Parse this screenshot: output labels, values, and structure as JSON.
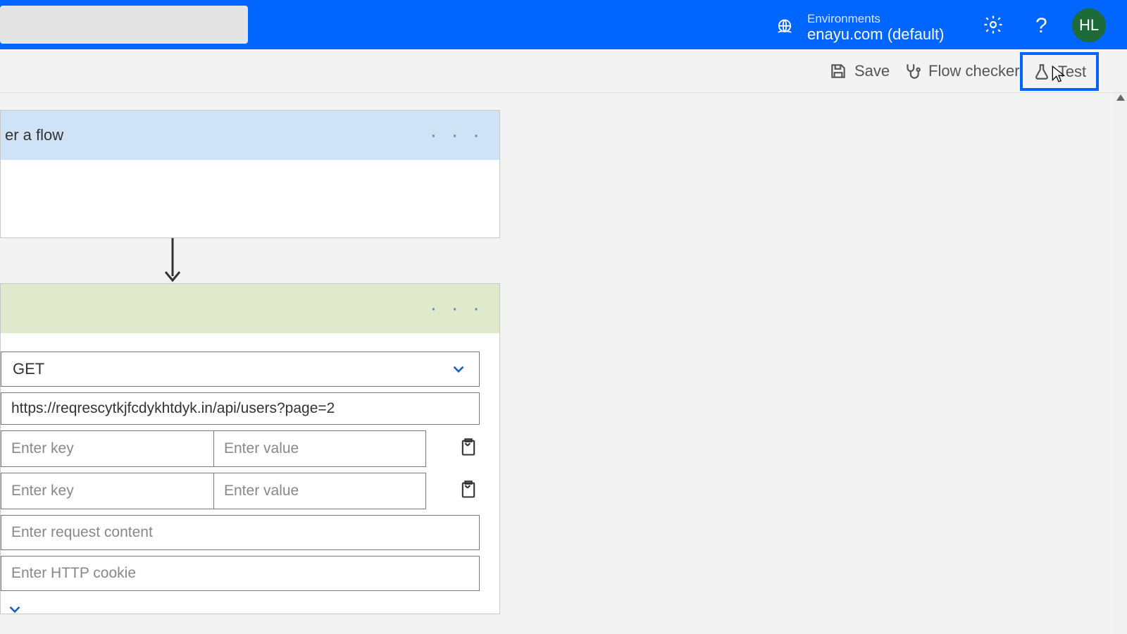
{
  "header": {
    "env_label": "Environments",
    "env_name": "enayu.com (default)",
    "avatar": "HL"
  },
  "toolbar": {
    "save": "Save",
    "checker": "Flow checker",
    "test": "Test"
  },
  "trigger": {
    "title": "er a flow"
  },
  "action": {
    "method": "GET",
    "url": "https://reqrescytkjfcdykhtdyk.in/api/users?page=2",
    "kv": [
      {
        "key_ph": "Enter key",
        "val_ph": "Enter value"
      },
      {
        "key_ph": "Enter key",
        "val_ph": "Enter value"
      }
    ],
    "body_ph": "Enter request content",
    "cookie_ph": "Enter HTTP cookie"
  }
}
